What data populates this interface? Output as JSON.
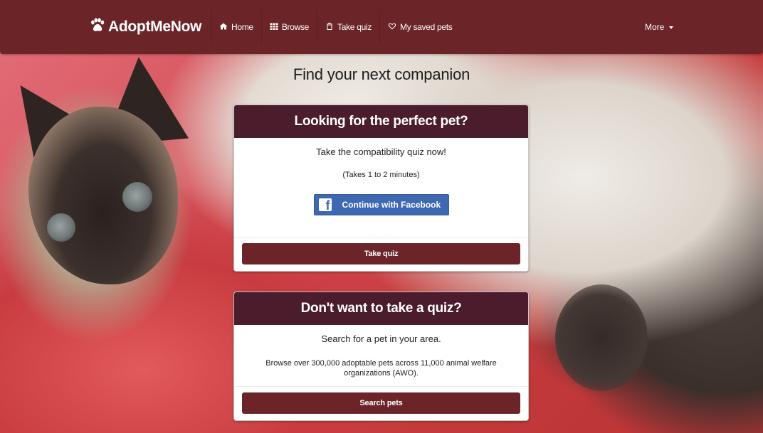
{
  "brand": {
    "name": "AdoptMeNow",
    "icon": "paw-icon"
  },
  "nav": {
    "items": [
      {
        "label": "Home",
        "icon": "home-icon"
      },
      {
        "label": "Browse",
        "icon": "grid-icon"
      },
      {
        "label": "Take quiz",
        "icon": "clipboard-icon"
      },
      {
        "label": "My saved pets",
        "icon": "heart-icon"
      }
    ],
    "more_label": "More"
  },
  "page_title": "Find your next companion",
  "quiz_card": {
    "title": "Looking for the perfect pet?",
    "lead": "Take the compatibility quiz now!",
    "note": "(Takes 1 to 2 minutes)",
    "facebook_label": "Continue with Facebook",
    "button_label": "Take quiz"
  },
  "search_card": {
    "title": "Don't want to take a quiz?",
    "lead": "Search for a pet in your area.",
    "description": "Browse over 300,000 adoptable pets across 11,000 animal welfare organizations (AWO).",
    "button_label": "Search pets"
  },
  "colors": {
    "navbar": "#6b2528",
    "card_header": "#4b1c2b",
    "primary_button": "#6b2528",
    "facebook": "#3f68b2"
  }
}
